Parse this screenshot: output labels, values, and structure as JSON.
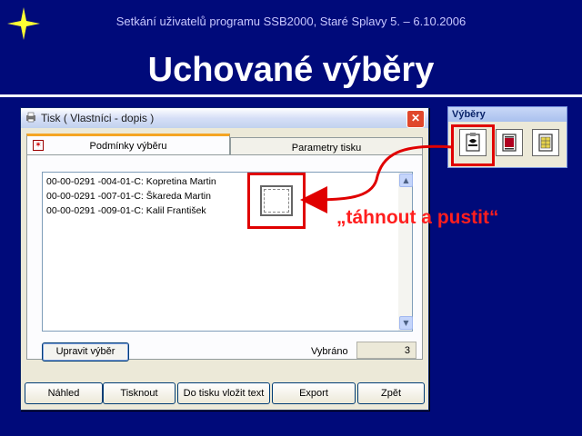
{
  "slide": {
    "header": "Setkání uživatelů programu SSB2000, Staré Splavy 5. – 6.10.2006",
    "title": "Uchované výběry",
    "annotation": "„táhnout a pustit“"
  },
  "window": {
    "title": "Tisk ( Vlastníci - dopis )",
    "close_label": "✕",
    "tabs": [
      {
        "label": "Podmínky výběru",
        "active": true,
        "icon": "filter-icon"
      },
      {
        "label": "Parametry tisku",
        "active": false
      }
    ],
    "list_items": [
      "00-00-0291 -004-01-C: Kopretina Martin",
      "00-00-0291 -007-01-C: Škareda Martin",
      "00-00-0291 -009-01-C: Kalil František"
    ],
    "edit_button": "Upravit výběr",
    "selected_label": "Vybráno",
    "selected_value": "3",
    "buttons": [
      "Náhled",
      "Tisknout",
      "Do tisku vložit text",
      "Export",
      "Zpět"
    ]
  },
  "palette": {
    "title": "Výběry",
    "icons": [
      "saved-selection-icon",
      "filmstrip-selection-icon",
      "grid-selection-icon"
    ]
  },
  "colors": {
    "slide_bg": "#000a7a",
    "accent_red": "#e00000",
    "tab_highlight": "#f5a523"
  }
}
